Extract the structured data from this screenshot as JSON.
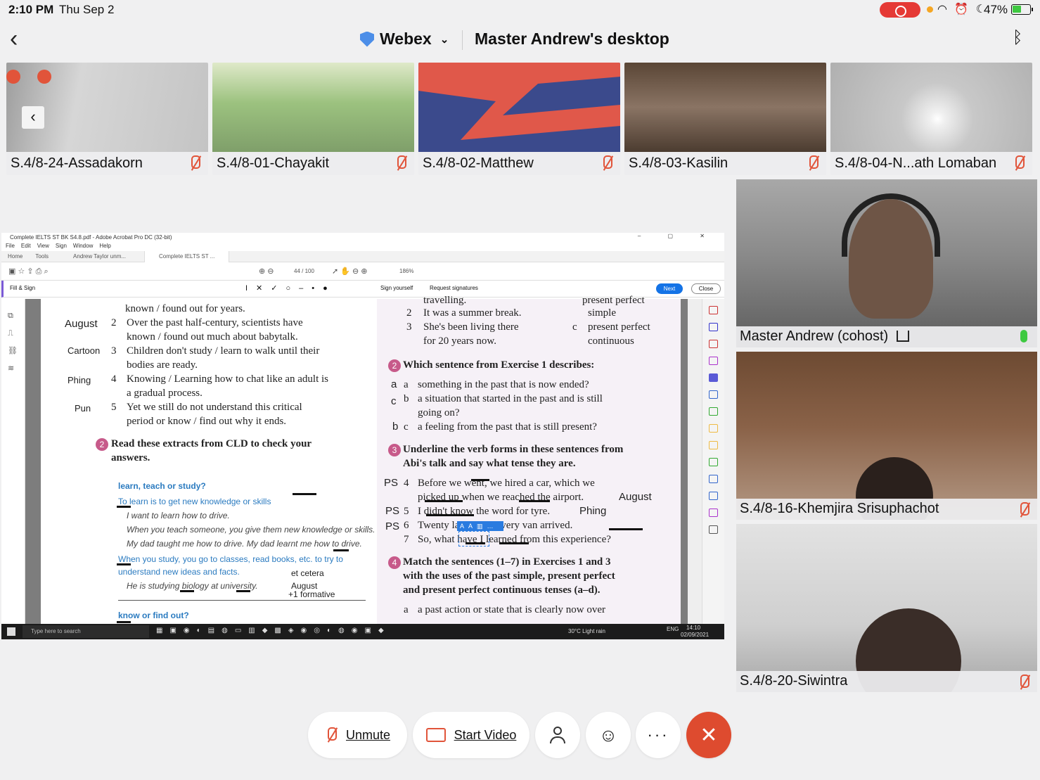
{
  "status_bar": {
    "time": "2:10 PM",
    "date": "Thu Sep 2",
    "battery": "47%"
  },
  "header": {
    "app_name": "Webex",
    "share_title": "Master Andrew's desktop"
  },
  "participants_strip": [
    {
      "name": "S.4/8-24-Assadakorn",
      "color": "#c9c9c9"
    },
    {
      "name": "S.4/8-01-Chayakit",
      "color": "#8fbf7a"
    },
    {
      "name": "S.4/8-02-Matthew",
      "color": "#3b4a8c"
    },
    {
      "name": "S.4/8-03-Kasilin",
      "color": "#6b5544"
    },
    {
      "name": "S.4/8-04-N...ath Lomaban",
      "color": "#d8d8d8"
    }
  ],
  "side_panels": [
    {
      "name": "Master Andrew (cohost)",
      "color": "#8a8a8a"
    },
    {
      "name": "S.4/8-16-Khemjira Srisuphachot",
      "color": "#6d4a32"
    },
    {
      "name": "S.4/8-20-Siwintra",
      "color": "#cfcfcf"
    }
  ],
  "acrobat": {
    "title": "Complete IELTS ST BK S4.8.pdf - Adobe Acrobat Pro DC (32-bit)",
    "menu": [
      "File",
      "Edit",
      "View",
      "Sign",
      "Window",
      "Help"
    ],
    "tabs": [
      "Home",
      "Tools",
      "Andrew Taylor unm...",
      "Complete IELTS ST ..."
    ],
    "page_indicator": "44 / 100",
    "zoom": "186%",
    "fill_sign": "Fill & Sign",
    "sign_yourself": "Sign yourself",
    "request_signatures": "Request signatures",
    "next": "Next",
    "close": "Close"
  },
  "doc_left": {
    "l0": "known / found out for years.",
    "l1": "Over the past half-century, scientists have",
    "l2": "known / found out much about babytalk.",
    "l3": "Children don't study / learn to walk until their",
    "l4": "bodies are ready.",
    "l5": "Knowing / Learning how to chat like an adult is",
    "l6": "a gradual process.",
    "l7": "Yet we still do not understand this critical",
    "l8": "period or know / find out why it ends.",
    "ex2a": "Read these extracts from CLD to check your",
    "ex2b": "answers.",
    "n2": "2",
    "n3": "3",
    "n4": "4",
    "n5": "5",
    "h_august": "August",
    "h_cartoon": "Cartoon",
    "h_phing": "Phing",
    "h_pun": "Pun",
    "b1": "learn, teach or study?",
    "b2": "To learn is to get new knowledge or skills",
    "b3": "I want to learn how to drive.",
    "b4": "When you teach someone, you give them new knowledge or skills.",
    "b5": "My dad taught me how to drive.  My dad learnt me how to drive.",
    "b6": "When you study, you go to classes, read books, etc. to try to",
    "b7": "understand new ideas and facts.",
    "b8": "He is studying biology at university.",
    "b9": "know or find out?",
    "h_etc": "et cetera",
    "h_aug2": "August",
    "h_form": "+1 formative"
  },
  "doc_right": {
    "r0": "travelling.",
    "r0b": "present perfect",
    "r1": "It was a summer break.",
    "r1b": "simple",
    "r2": "She's been living there",
    "r2b": "present perfect",
    "r3": "for 20 years now.",
    "r3b": "continuous",
    "ex2": "Which sentence from Exercise 1 describes:",
    "q_a": "something in the past that is now ended?",
    "q_b": "a situation that started in the past and is still",
    "q_b2": "going on?",
    "q_c": "a feeling from the past that is still present?",
    "ex3a": "Underline the verb forms in these sentences from",
    "ex3b": "Abi's talk and say what tense they are.",
    "s4": "Before we went, we hired a car, which we",
    "s4b": "picked up when we reached the airport.",
    "s5": "I didn't know the word for tyre.",
    "s6": "Twenty          later, a recovery van arrived.",
    "s7": "So, what have I learned from this experience?",
    "ex4a": "Match the sentences (1–7) in Exercises 1 and 3",
    "ex4b": "with the uses of the past simple, present perfect",
    "ex4c": "and present perfect continuous tenses (a–d).",
    "m_a": "a past action or state that is clearly now over",
    "ha": "a",
    "hc": "c",
    "hb": "b",
    "ps": "PS",
    "ps5": "PS",
    "ps6": "PS",
    "h_aug": "August",
    "h_phing": "Phing",
    "k1": "2",
    "k2": "3",
    "k4": "4",
    "k5": "5",
    "k6": "6",
    "k7": "7",
    "la": "a",
    "lb": "b",
    "lc": "c",
    "lbb": "b",
    "lcc": "c",
    "n2": "2",
    "n3": "3",
    "n4": "4"
  },
  "taskbar": {
    "search": "Type here to search",
    "weather": "30°C  Light rain",
    "lang": "ENG",
    "time": "14:10",
    "date": "02/09/2021"
  },
  "controls": {
    "unmute": "Unmute",
    "start_video": "Start Video"
  }
}
